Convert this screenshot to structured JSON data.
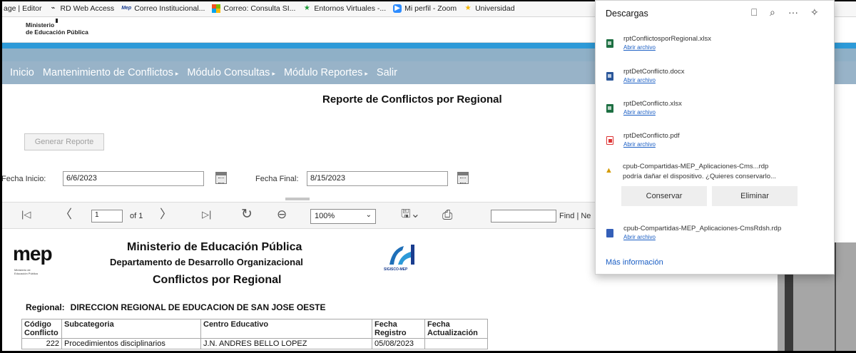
{
  "bookmarks": [
    {
      "icon": "page-icon",
      "label": "age | Editor"
    },
    {
      "icon": "rd-icon",
      "label": "RD Web Access",
      "glyph": "⌁"
    },
    {
      "icon": "mep-icon",
      "label": "Correo Institucional...",
      "glyph": "Mep"
    },
    {
      "icon": "microsoft-icon",
      "label": "Correo: Consulta SI..."
    },
    {
      "icon": "star-icon",
      "label": "Entornos Virtuales -...",
      "glyph": "★"
    },
    {
      "icon": "zoom-icon",
      "label": "Mi perfil - Zoom",
      "glyph": "▶"
    },
    {
      "icon": "star-yellow-icon",
      "label": "Universidad",
      "glyph": "★"
    }
  ],
  "header": {
    "ministry_line1": "Ministerio",
    "ministry_line2": "de Educación Pública"
  },
  "nav": [
    {
      "label": "Inicio",
      "arrow": ""
    },
    {
      "label": "Mantenimiento de Conflictos",
      "arrow": "▸"
    },
    {
      "label": "Módulo Consultas",
      "arrow": "▸"
    },
    {
      "label": "Módulo Reportes",
      "arrow": "▸"
    },
    {
      "label": "Salir",
      "arrow": ""
    }
  ],
  "report": {
    "title": "Reporte de Conflictos por Regional",
    "generate_label": "Generar Reporte",
    "start_label": "Fecha Inicio:",
    "start_value": "6/6/2023",
    "end_label": "Fecha Final:",
    "end_value": "8/15/2023"
  },
  "viewer": {
    "first": "|◁",
    "prev": "〈",
    "page_value": "1",
    "of_label": "of 1",
    "next": "〉",
    "last": "▷|",
    "refresh": "↻",
    "back": "⊖",
    "zoom_value": "100%",
    "zoom_caret": "⌄",
    "export": "🖫⌄",
    "print": "⎙",
    "find_placeholder": "",
    "find_label": "Find | Ne"
  },
  "document": {
    "logo_text": "mep",
    "logo_sub": "Ministerio de Educación Pública",
    "h1": "Ministerio de Educación Pública",
    "h2": "Departamento de Desarrollo Organizacional",
    "h3": "Conflictos por Regional",
    "sigisco_caption": "SIGISCO-MEP",
    "regional_label": "Regional:",
    "regional_value": "DIRECCION REGIONAL DE EDUCACION DE SAN JOSE OESTE",
    "table": {
      "headers": [
        "Código Conflicto",
        "Subcategoria",
        "Centro Educativo",
        "Fecha Registro",
        "Fecha Actualización"
      ],
      "rows": [
        [
          "222",
          "Procedimientos disciplinarios",
          "J.N. ANDRES BELLO LOPEZ",
          "05/08/2023",
          ""
        ]
      ]
    }
  },
  "downloads": {
    "title": "Descargas",
    "actions": [
      "⎕",
      "⌕",
      "···",
      "✧"
    ],
    "items": [
      {
        "name": "rptConflictosporRegional.xlsx",
        "link": "Abrir archivo",
        "type": "xls"
      },
      {
        "name": "rptDetConflicto.docx",
        "link": "Abrir archivo",
        "type": "doc"
      },
      {
        "name": "rptDetConflicto.xlsx",
        "link": "Abrir archivo",
        "type": "xls"
      },
      {
        "name": "rptDetConflicto.pdf",
        "link": "Abrir archivo",
        "type": "pdf"
      }
    ],
    "warning": {
      "icon": "▲",
      "name": "cpub-Compartidas-MEP_Aplicaciones-Cms...rdp",
      "text": "podría dañar el dispositivo. ¿Quieres conservarlo...",
      "keep": "Conservar",
      "delete": "Eliminar"
    },
    "last_item": {
      "name": "cpub-Compartidas-MEP_Aplicaciones-CmsRdsh.rdp",
      "link": "Abrir archivo",
      "type": "rdp"
    },
    "more_info": "Más información"
  },
  "colors": {
    "nav_bg": "#98b3c8",
    "strip_blue": "#2d9ad8",
    "link_blue": "#1a5ec4"
  }
}
